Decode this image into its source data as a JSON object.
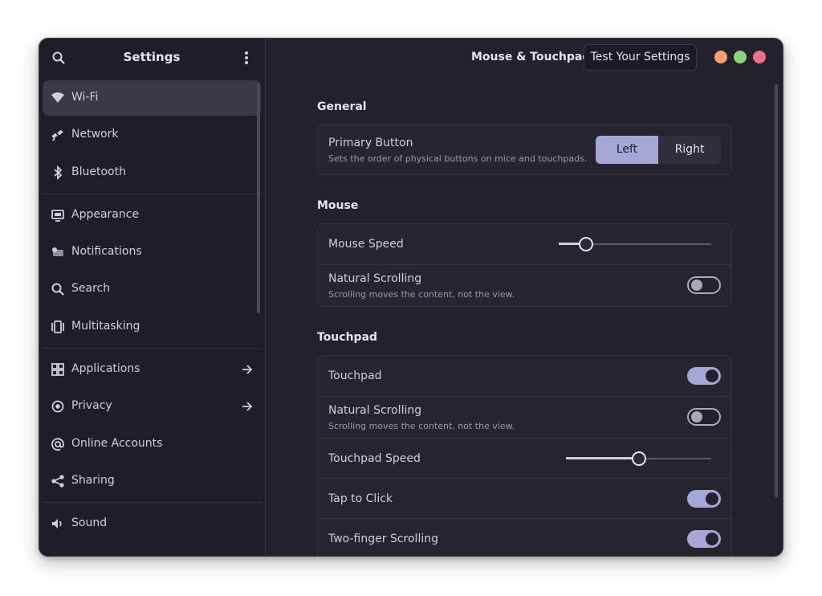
{
  "sidebar": {
    "title": "Settings",
    "items": [
      {
        "label": "Wi-Fi",
        "icon": "wifi-icon",
        "active": true
      },
      {
        "label": "Network",
        "icon": "network-icon"
      },
      {
        "label": "Bluetooth",
        "icon": "bluetooth-icon"
      },
      {
        "label": "Appearance",
        "icon": "appearance-icon"
      },
      {
        "label": "Notifications",
        "icon": "notifications-icon"
      },
      {
        "label": "Search",
        "icon": "search-icon"
      },
      {
        "label": "Multitasking",
        "icon": "multitasking-icon"
      },
      {
        "label": "Applications",
        "icon": "applications-icon",
        "arrow": true
      },
      {
        "label": "Privacy",
        "icon": "privacy-icon",
        "arrow": true
      },
      {
        "label": "Online Accounts",
        "icon": "online-accounts-icon"
      },
      {
        "label": "Sharing",
        "icon": "sharing-icon"
      },
      {
        "label": "Sound",
        "icon": "sound-icon"
      }
    ]
  },
  "header": {
    "title": "Mouse & Touchpad",
    "test_button": "Test Your Settings"
  },
  "window_controls": {
    "colors": [
      "#f5a26e",
      "#8fd477",
      "#ef6f86"
    ]
  },
  "general": {
    "title": "General",
    "primary_button": {
      "label": "Primary Button",
      "description": "Sets the order of physical buttons on mice and touchpads.",
      "options": [
        "Left",
        "Right"
      ],
      "selected": "Left"
    }
  },
  "mouse": {
    "title": "Mouse",
    "speed": {
      "label": "Mouse Speed",
      "value": 0.18
    },
    "natural_scrolling": {
      "label": "Natural Scrolling",
      "description": "Scrolling moves the content, not the view.",
      "enabled": false
    }
  },
  "touchpad": {
    "title": "Touchpad",
    "touchpad": {
      "label": "Touchpad",
      "enabled": true
    },
    "natural_scrolling": {
      "label": "Natural Scrolling",
      "description": "Scrolling moves the content, not the view.",
      "enabled": false
    },
    "speed": {
      "label": "Touchpad Speed",
      "value": 0.5
    },
    "tap_to_click": {
      "label": "Tap to Click",
      "enabled": true
    },
    "two_finger_scrolling": {
      "label": "Two-finger Scrolling",
      "enabled": true
    }
  },
  "colors": {
    "accent": "#a5a8d6",
    "background": "#22212c"
  }
}
